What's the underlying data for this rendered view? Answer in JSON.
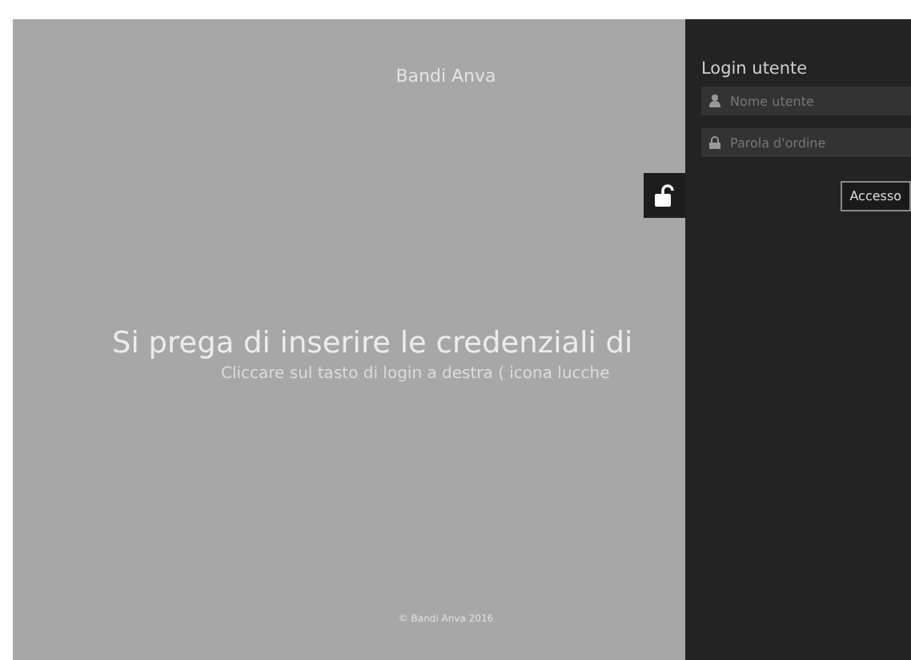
{
  "page": {
    "title": "Bandi Anva",
    "heading": "Si prega di inserire le credenziali di",
    "subheading": "Cliccare sul tasto di login a destra ( icona lucche",
    "footer": "© Bandi Anva 2016"
  },
  "login_panel": {
    "title": "Login utente",
    "username": {
      "placeholder": "Nome utente"
    },
    "password": {
      "placeholder": "Parola d'ordine"
    },
    "submit": "Accesso"
  }
}
